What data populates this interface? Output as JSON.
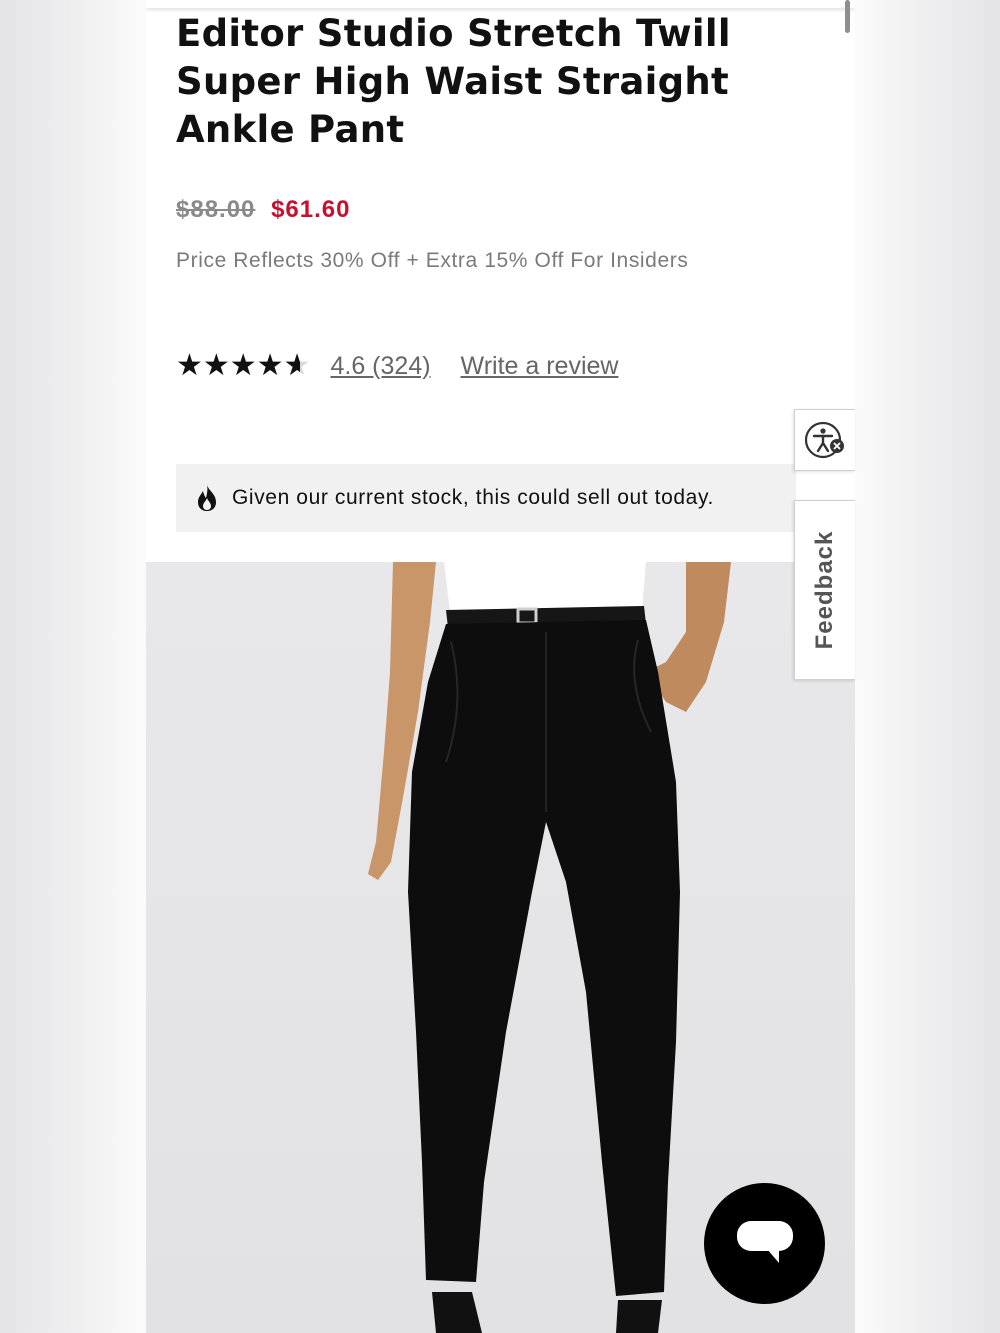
{
  "product": {
    "title": "Editor Studio Stretch Twill Super High Waist Straight Ankle Pant",
    "original_price": "$88.00",
    "sale_price": "$61.60",
    "promo_text": "Price Reflects 30% Off + Extra 15% Off For Insiders"
  },
  "rating": {
    "stars": "★★★★★",
    "value": 4.6,
    "max": 5,
    "summary": "4.6 (324)",
    "write_review_label": "Write a review"
  },
  "stock_banner": {
    "icon": "flame-icon",
    "text": "Given our current stock, this could sell out today."
  },
  "image": {
    "subject": "product-photo"
  },
  "side_widgets": {
    "accessibility_icon": "accessibility-icon",
    "feedback_label": "Feedback"
  },
  "chat": {
    "icon": "chat-bubble-icon"
  },
  "colors": {
    "sale_price": "#c8102e",
    "text_primary": "#111111",
    "text_muted": "#7a7a7a",
    "banner_bg": "#f1f1f1"
  }
}
